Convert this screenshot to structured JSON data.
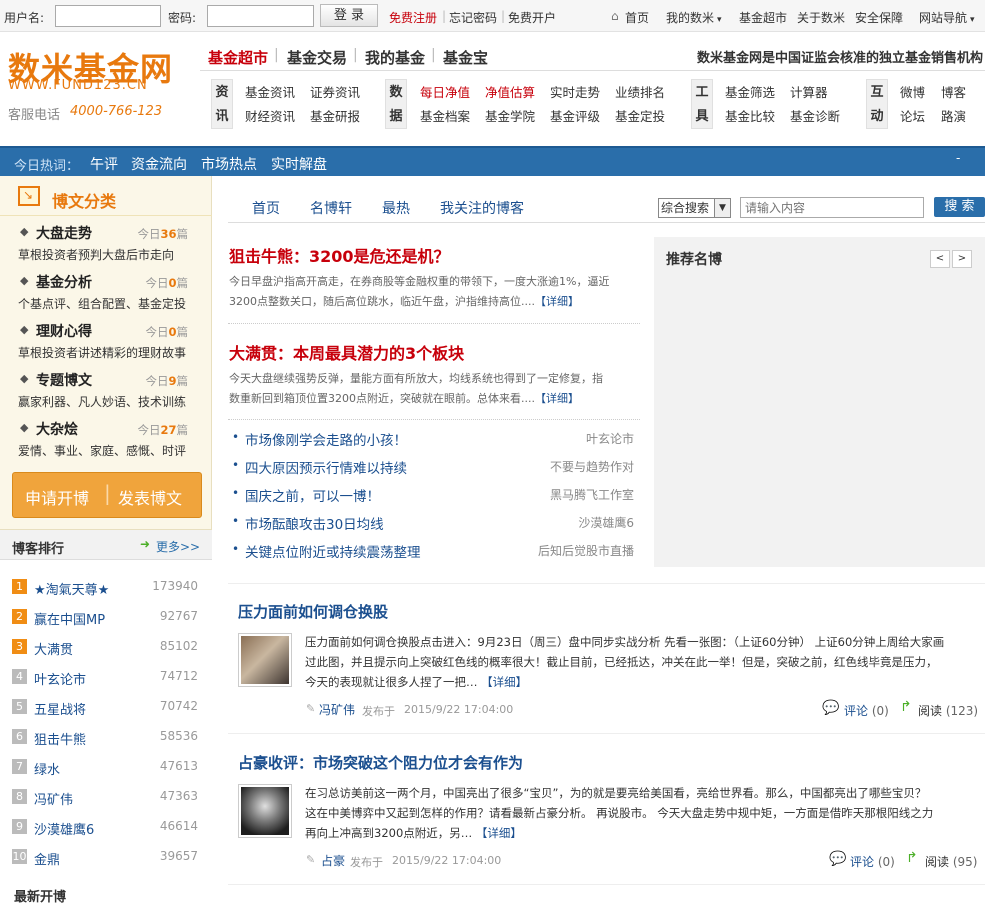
{
  "topbar": {
    "username_label": "用户名:",
    "password_label": "密码:",
    "login_label": "登 录",
    "register_label": "免费注册",
    "forgot_label": "忘记密码",
    "open_account_label": "免费开户",
    "home_label": "首页",
    "my_shumi_label": "我的数米",
    "fund_market_label": "基金超市",
    "about_label": "关于数米",
    "security_label": "安全保障",
    "sitemap_label": "网站导航"
  },
  "header": {
    "logo_text": "数米基金网",
    "logo_url": "WWW.FUND123.CN",
    "hotline_label": "客服电话",
    "hotline": "4000-766-123",
    "main_nav": [
      "基金超市",
      "基金交易",
      "我的基金",
      "基金宝"
    ],
    "slogan": "数米基金网是中国证监会核准的独立基金销售机构",
    "groups": [
      {
        "label": "资讯",
        "links": [
          "基金资讯",
          "证券资讯",
          "财经资讯",
          "基金研报"
        ]
      },
      {
        "label": "数据",
        "links": [
          "每日净值",
          "净值估算",
          "实时走势",
          "业绩排名",
          "基金档案",
          "基金学院",
          "基金评级",
          "基金定投"
        ]
      },
      {
        "label": "工具",
        "links": [
          "基金筛选",
          "计算器",
          "基金比较",
          "基金诊断"
        ]
      },
      {
        "label": "互动",
        "links": [
          "微博",
          "博客",
          "论坛",
          "路演"
        ]
      }
    ]
  },
  "hotbar": {
    "label": "今日热词：",
    "words": [
      "午评",
      "资金流向",
      "市场热点",
      "实时解盘"
    ]
  },
  "sidebar": {
    "title": "博文分类",
    "categories": [
      {
        "name": "大盘走势",
        "today": "今日",
        "count": "36",
        "unit": "篇",
        "desc": "草根投资者预判大盘后市走向"
      },
      {
        "name": "基金分析",
        "today": "今日",
        "count": "0",
        "unit": "篇",
        "desc": "个基点评、组合配置、基金定投"
      },
      {
        "name": "理财心得",
        "today": "今日",
        "count": "0",
        "unit": "篇",
        "desc": "草根投资者讲述精彩的理财故事"
      },
      {
        "name": "专题博文",
        "today": "今日",
        "count": "9",
        "unit": "篇",
        "desc": "赢家利器、凡人妙语、技术训练"
      },
      {
        "name": "大杂烩",
        "today": "今日",
        "count": "27",
        "unit": "篇",
        "desc": "爱情、事业、家庭、感慨、时评"
      }
    ],
    "apply_label": "申请开博",
    "publish_label": "发表博文",
    "rank_title": "博客排行",
    "rank_more": "更多>>",
    "ranks": [
      {
        "n": "1",
        "name": "★淘氣天尊★",
        "score": "173940"
      },
      {
        "n": "2",
        "name": "赢在中国MP",
        "score": "92767"
      },
      {
        "n": "3",
        "name": "大满贯",
        "score": "85102"
      },
      {
        "n": "4",
        "name": "叶玄论市",
        "score": "74712"
      },
      {
        "n": "5",
        "name": "五星战将",
        "score": "70742"
      },
      {
        "n": "6",
        "name": "狙击牛熊",
        "score": "58536"
      },
      {
        "n": "7",
        "name": "绿水",
        "score": "47613"
      },
      {
        "n": "8",
        "name": "冯矿伟",
        "score": "47363"
      },
      {
        "n": "9",
        "name": "沙漠雄鹰6",
        "score": "46614"
      },
      {
        "n": "10",
        "name": "金鼎",
        "score": "39657"
      }
    ],
    "latest_title": "最新开博"
  },
  "content": {
    "tabs": [
      "首页",
      "名博轩",
      "最热",
      "我关注的博客"
    ],
    "search_select": "综合搜索",
    "search_placeholder": "请输入内容",
    "search_btn": "搜 索",
    "featured": [
      {
        "title": "狙击牛熊：3200是危还是机？",
        "line1": "今日早盘沪指高开高走，在券商股等金融权重的带领下，一度大涨逾1%，逼近",
        "line2": "3200点整数关口，随后高位跳水，临近午盘，沪指维持高位....",
        "more": "【详细】"
      },
      {
        "title": "大满贯：本周最具潜力的3个板块",
        "line1": "今天大盘继续强势反弹，量能方面有所放大，均线系统也得到了一定修复，指",
        "line2": "数重新回到箱顶位置3200点附近，突破就在眼前。总体来看....",
        "more": "【详细】"
      }
    ],
    "list": [
      {
        "title": "市场像刚学会走路的小孩！",
        "author": "叶玄论市"
      },
      {
        "title": "四大原因预示行情难以持续",
        "author": "不要与趋势作对"
      },
      {
        "title": "国庆之前，可以一博！",
        "author": "黑马腾飞工作室"
      },
      {
        "title": "市场酝酿攻击30日均线",
        "author": "沙漠雄鹰6"
      },
      {
        "title": "关键点位附近或持续震荡整理",
        "author": "后知后觉股市直播"
      }
    ],
    "recommend_title": "推荐名博",
    "posts": [
      {
        "title": "压力面前如何调仓换股",
        "line1": "压力面前如何调仓换股点击进入：9月23日（周三）盘中同步实战分析  先看一张图：（上证60分钟）  上证60分钟上周给大家画",
        "line2": "过此图，并且提示向上突破红色线的概率很大！截止目前，已经抵达，冲关在此一举！但是，突破之前，红色线毕竟是压力，",
        "line3": "今天的表现就让很多人捏了一把…",
        "more": "【详细】",
        "author": "冯矿伟",
        "posted": "发布于",
        "time": "2015/9/22  17:04:00",
        "comment_label": "评论",
        "comments": "(0)",
        "read_label": "阅读",
        "reads": "(123)"
      },
      {
        "title": "占豪收评：市场突破这个阻力位才会有作为",
        "line1": "在习总访美前这一两个月，中国亮出了很多“宝贝”，为的就是要亮给美国看，亮给世界看。那么，中国都亮出了哪些宝贝？",
        "line2": "这在中美博弈中又起到怎样的作用？请看最新占豪分析。  再说股市。  今天大盘走势中规中矩，一方面是借昨天那根阳线之力",
        "line3": "再向上冲高到3200点附近，另…",
        "more": "【详细】",
        "author": "占豪",
        "posted": "发布于",
        "time": "2015/9/22  17:04:00",
        "comment_label": "评论",
        "comments": "(0)",
        "read_label": "阅读",
        "reads": "(95)"
      }
    ]
  },
  "colors": {
    "brand_orange": "#e8790e",
    "accent_red": "#c7000b",
    "link_blue": "#1b4f8f",
    "bar_blue": "#2a6eaa"
  }
}
